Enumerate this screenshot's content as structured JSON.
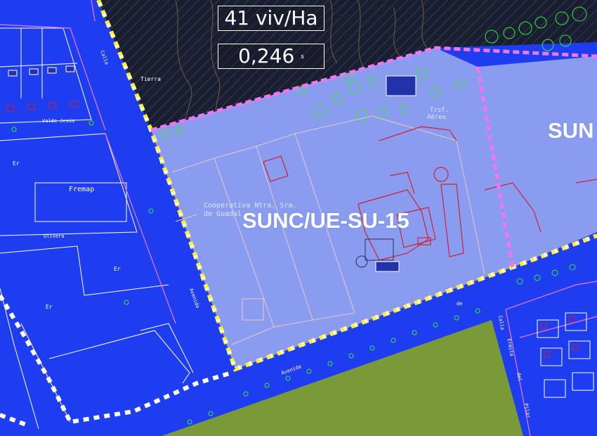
{
  "map": {
    "density": "41 viv/Ha",
    "coefficient": "0,246",
    "coefficient_unit": "s",
    "zone_main": "SUNC/UE-SU-15",
    "zone_right": "SUN",
    "coop_line1": "Cooperativa Ntra. Sra.",
    "coop_line2": "de Guadal",
    "trsf_line1": "Trsf.",
    "trsf_line2": "Aéreo",
    "tierra": "Tierra",
    "fremap": "Fremap",
    "er1": "Er",
    "er2": "Er",
    "er3": "Er",
    "calle_top": "Calle",
    "valdejesus": "Valde Jesús",
    "olivera": "Olivera",
    "avenida_side": "Avenida",
    "avenida_bottom": "Avenida",
    "de": "de",
    "calle_right": "Calle",
    "ermita": "Ermita",
    "del": "del",
    "pilar": "Pilar",
    "colors": {
      "road": "#1f3df0",
      "zone_fill": "#8a9cf0",
      "dark_area": "#1a1d2e",
      "green_park": "#7a9a3a",
      "boundary_yellow": "#ffee33",
      "boundary_magenta": "#ee77ee",
      "building_red": "#cc2233",
      "tree_green": "#33ee33"
    }
  }
}
